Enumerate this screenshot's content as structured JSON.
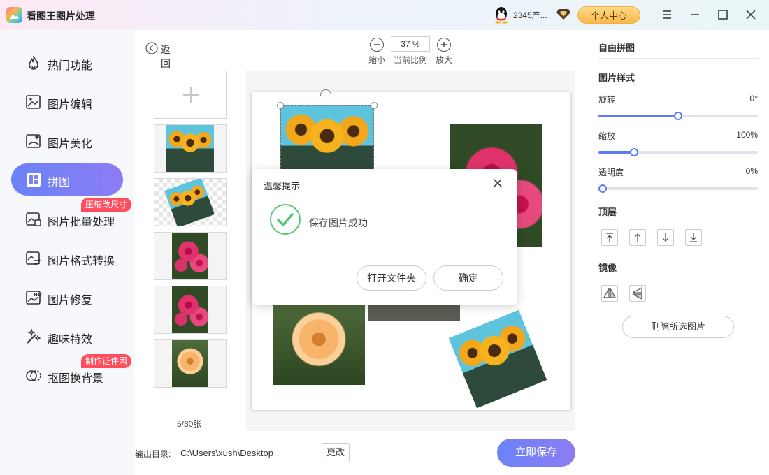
{
  "titlebar": {
    "app_title": "看图王图片处理",
    "user_name": "2345产...",
    "personal_center": "个人中心",
    "window_icons": [
      "menu-icon",
      "minimize-icon",
      "maximize-icon",
      "close-icon"
    ]
  },
  "sidebar": {
    "items": [
      {
        "label": "热门功能",
        "icon": "fire-icon"
      },
      {
        "label": "图片编辑",
        "icon": "image-edit-icon"
      },
      {
        "label": "图片美化",
        "icon": "image-beautify-icon"
      },
      {
        "label": "拼图",
        "icon": "collage-icon",
        "active": true
      },
      {
        "label": "图片批量处理",
        "icon": "batch-icon",
        "badge": "压缩改尺寸"
      },
      {
        "label": "图片格式转换",
        "icon": "convert-icon"
      },
      {
        "label": "图片修复",
        "icon": "hd-repair-icon"
      },
      {
        "label": "趣味特效",
        "icon": "magic-icon"
      },
      {
        "label": "抠图换背景",
        "icon": "cutout-icon",
        "badge": "制作证件照"
      }
    ]
  },
  "toolbar": {
    "back_label": "返回",
    "zoom_out_label": "缩小",
    "zoom_value": "37 %",
    "zoom_ratio_label": "当前比例",
    "zoom_in_label": "放大"
  },
  "thumbnails": {
    "counter": "5/30张"
  },
  "dialog": {
    "title": "温馨提示",
    "message": "保存图片成功",
    "open_folder": "打开文件夹",
    "confirm": "确定"
  },
  "bottom": {
    "output_label": "输出目录:",
    "output_path": "C:\\Users\\xush\\Desktop",
    "change_label": "更改",
    "save_label": "立即保存"
  },
  "right_panel": {
    "title": "自由拼图",
    "style_section": "图片样式",
    "rotate_label": "旋转",
    "rotate_value": "0°",
    "rotate_level": 0.5,
    "scale_label": "缩放",
    "scale_value": "100%",
    "scale_level": 0.225,
    "opacity_label": "透明度",
    "opacity_value": "0%",
    "opacity_level": 0,
    "layer_section": "顶层",
    "layer_tools": [
      "bring-to-top-icon",
      "move-up-icon",
      "move-down-icon",
      "send-to-bottom-icon"
    ],
    "mirror_section": "镜像",
    "mirror_tools": [
      "flip-horizontal-icon",
      "flip-vertical-icon"
    ],
    "delete_label": "删除所选图片"
  },
  "colors": {
    "accent": "#6b82f7",
    "badge": "#ff4d5e",
    "success": "#56c776",
    "personal_btn": "#f9b94a"
  }
}
